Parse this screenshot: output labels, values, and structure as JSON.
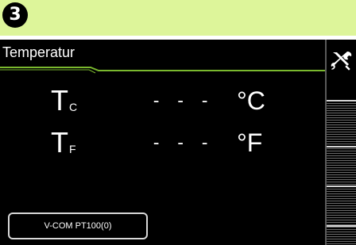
{
  "banner": {
    "step_number": "3",
    "background_color": "#ddf59a"
  },
  "screen": {
    "title": "Temperatur",
    "accent_color": "#7ab82e",
    "rows": [
      {
        "symbol": "T",
        "subscript": "C",
        "value": "- - -",
        "unit": "°C"
      },
      {
        "symbol": "T",
        "subscript": "F",
        "value": "- - -",
        "unit": "°F"
      }
    ],
    "sensor_button_label": "V-COM PT100(0)"
  },
  "side_panel": {
    "tools_icon": "tools-icon"
  }
}
